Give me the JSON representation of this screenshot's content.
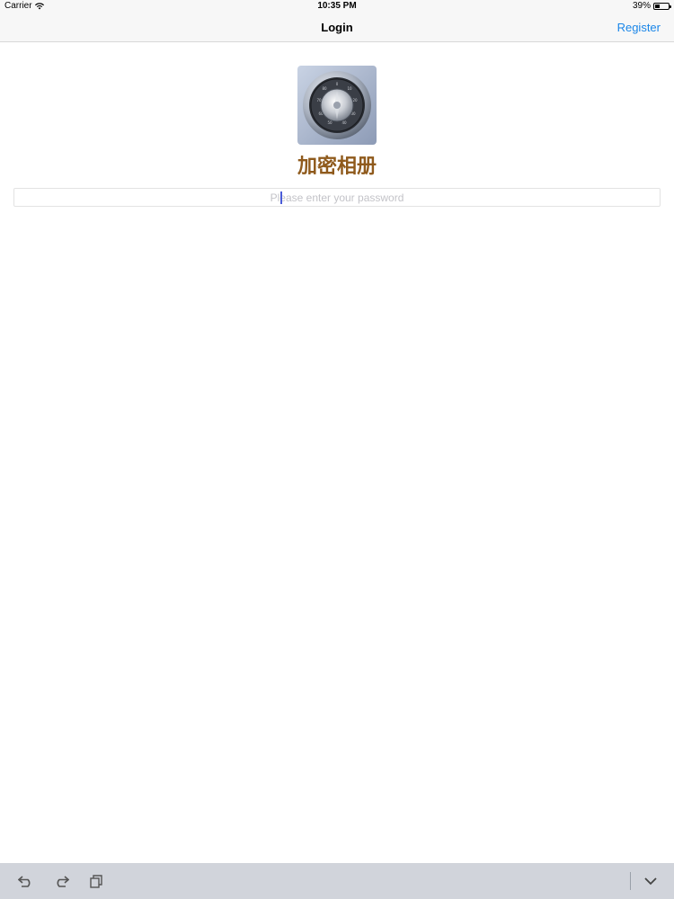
{
  "status_bar": {
    "carrier": "Carrier",
    "time": "10:35 PM",
    "battery": "39%",
    "battery_level": 0.39
  },
  "nav": {
    "title": "Login",
    "register_label": "Register"
  },
  "app": {
    "name": "加密相册"
  },
  "password": {
    "placeholder": "Please enter your password",
    "value": ""
  },
  "keyboard_toolbar": {
    "undo_icon": "undo-icon",
    "redo_icon": "redo-icon",
    "paste_icon": "paste-icon",
    "dismiss_icon": "chevron-down-icon"
  },
  "colors": {
    "accent": "#1a86e8",
    "app_name": "#8f5a1c"
  }
}
